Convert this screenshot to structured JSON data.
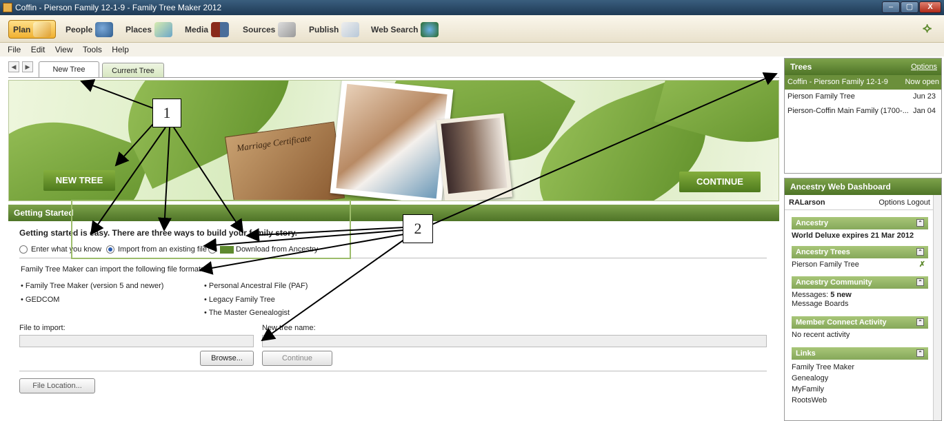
{
  "window": {
    "title": "Coffin - Pierson Family 12-1-9 - Family Tree Maker 2012",
    "controls": [
      "–",
      "▢",
      "X"
    ]
  },
  "workspaces": [
    {
      "label": "Plan",
      "icon": "plan-icon"
    },
    {
      "label": "People",
      "icon": "people-icon"
    },
    {
      "label": "Places",
      "icon": "places-icon"
    },
    {
      "label": "Media",
      "icon": "media-icon"
    },
    {
      "label": "Sources",
      "icon": "sources-icon"
    },
    {
      "label": "Publish",
      "icon": "publish-icon"
    },
    {
      "label": "Web Search",
      "icon": "web-search-icon"
    }
  ],
  "menu": {
    "file": "File",
    "edit": "Edit",
    "view": "View",
    "tools": "Tools",
    "help": "Help"
  },
  "tabs": {
    "new_tree": "New Tree",
    "current_tree": "Current Tree",
    "back": "◀",
    "forward": "▶"
  },
  "banner": {
    "new_tree": "NEW TREE",
    "continue": "CONTINUE",
    "certificate": "Marriage Certificate"
  },
  "getting_started": {
    "header": "Getting Started",
    "intro": "Getting started is easy. There are three ways to build your family story.",
    "options": {
      "enter": "Enter what you know",
      "import": "Import from an existing file",
      "download": "Download from Ancestry"
    },
    "formats_label": "Family Tree Maker can import the following file formats:",
    "formats_left": [
      "• Family Tree Maker (version 5 and newer)",
      "• GEDCOM"
    ],
    "formats_right": [
      "• Personal Ancestral File (PAF)",
      "• Legacy Family Tree",
      "• The Master Genealogist"
    ],
    "file_to_import_label": "File to import:",
    "new_tree_name_label": "New tree name:",
    "file_to_import_value": "",
    "new_tree_name_value": "",
    "browse": "Browse...",
    "continue": "Continue",
    "file_location": "File Location..."
  },
  "trees_panel": {
    "header": "Trees",
    "options": "Options",
    "rows": [
      {
        "name": "Coffin - Pierson Family 12-1-9",
        "date": "Now open"
      },
      {
        "name": "Pierson Family Tree",
        "date": "Jun 23"
      },
      {
        "name": "Pierson-Coffin Main Family (1700-...",
        "date": "Jan 04"
      }
    ]
  },
  "dashboard": {
    "header": "Ancestry Web Dashboard",
    "user": "RALarson",
    "options_logout": "Options Logout",
    "sections": {
      "ancestry": {
        "title": "Ancestry",
        "text": "World Deluxe expires 21 Mar 2012"
      },
      "trees": {
        "title": "Ancestry Trees",
        "text": "Pierson Family Tree"
      },
      "community": {
        "title": "Ancestry Community",
        "messages_prefix": "Messages: ",
        "messages_count": "5 new",
        "boards": "Message Boards"
      },
      "member": {
        "title": "Member Connect Activity",
        "text": "No recent activity"
      },
      "links": {
        "title": "Links",
        "items": [
          "Family Tree Maker",
          "Genealogy",
          "MyFamily",
          "RootsWeb"
        ]
      }
    }
  },
  "annotations": {
    "one": "1",
    "two": "2"
  },
  "colors": {
    "accent_green": "#5e8a2e",
    "selected_row": "#6b8f3b",
    "plan_tab": "#f0b030"
  }
}
